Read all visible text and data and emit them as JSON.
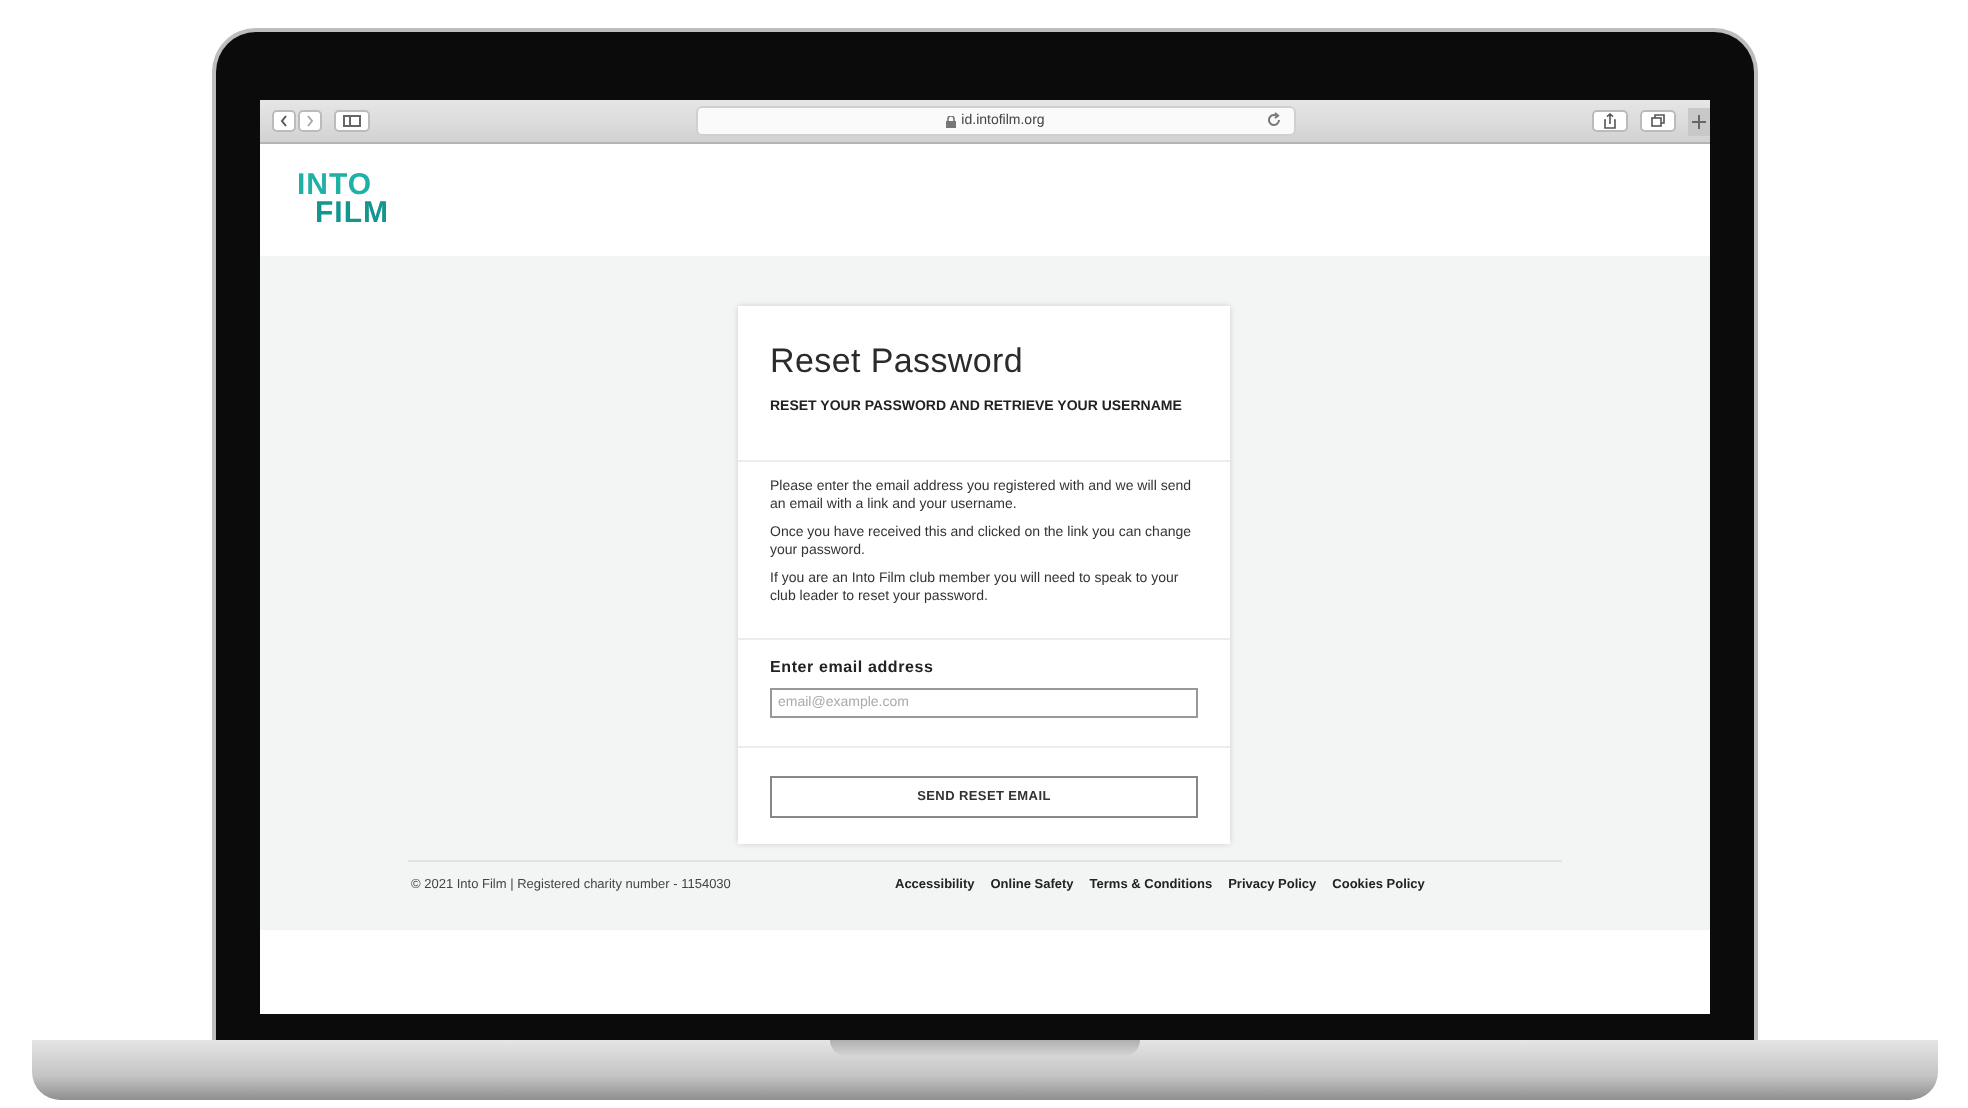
{
  "browser": {
    "url": "id.intofilm.org"
  },
  "logo": {
    "lines": [
      "INTO",
      "FILM"
    ]
  },
  "card": {
    "title": "Reset Password",
    "subtitle": "RESET YOUR PASSWORD AND RETRIEVE YOUR USERNAME",
    "paragraphs": [
      "Please enter the email address you registered with and we will send an email with a link and your username.",
      "Once you have received this and clicked on the link you can change your password.",
      "If you are an Into Film club member you will need to speak to your club leader to reset your password."
    ],
    "field": {
      "label": "Enter email address",
      "placeholder": "email@example.com"
    },
    "button": "SEND RESET EMAIL"
  },
  "footer": {
    "copyright": "© 2021 Into Film | Registered charity number - 1154030",
    "links": [
      "Accessibility",
      "Online Safety",
      "Terms & Conditions",
      "Privacy Policy",
      "Cookies Policy"
    ]
  }
}
